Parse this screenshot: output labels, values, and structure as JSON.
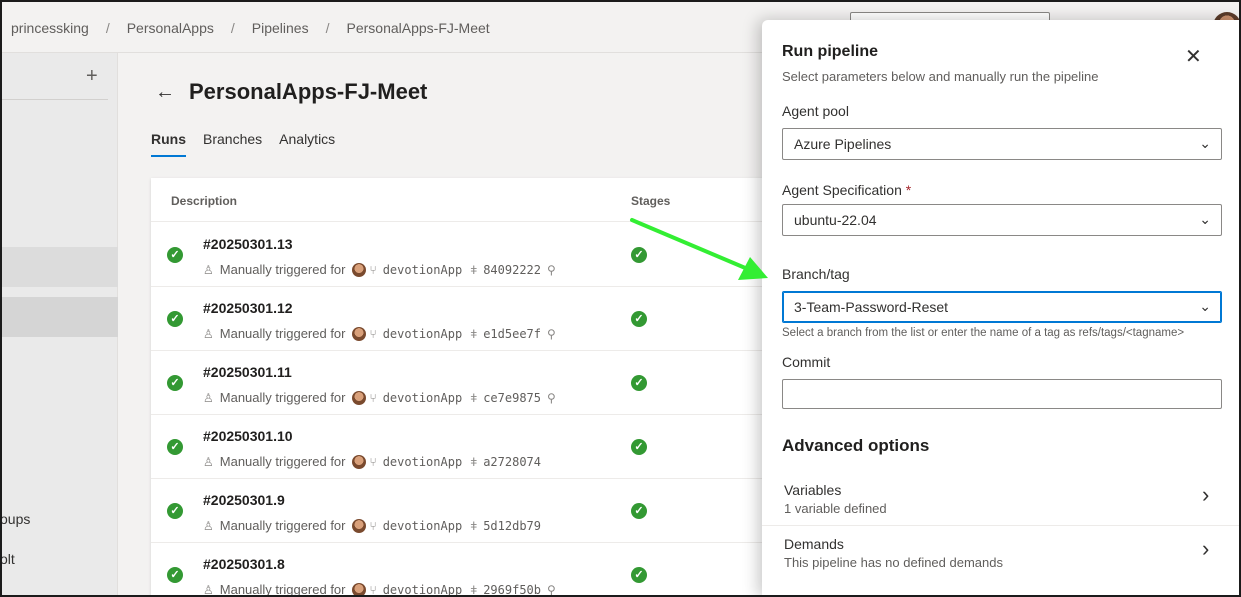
{
  "breadcrumb": [
    "princessking",
    "PersonalApps",
    "Pipelines",
    "PersonalApps-FJ-Meet"
  ],
  "breadcrumb_sep": "/",
  "sidebar": {
    "plus_label": "+",
    "items": [
      "oups",
      "olt"
    ]
  },
  "page": {
    "back_icon": "←",
    "title": "PersonalApps-FJ-Meet",
    "tabs": [
      "Runs",
      "Branches",
      "Analytics"
    ],
    "active_tab": "Runs"
  },
  "table": {
    "headers": {
      "description": "Description",
      "stages": "Stages"
    },
    "trigger_text": "Manually triggered for",
    "repo": "devotionApp",
    "rows": [
      {
        "id": "#20250301.13",
        "commit": "84092222",
        "pinned": true
      },
      {
        "id": "#20250301.12",
        "commit": "e1d5ee7f",
        "pinned": true
      },
      {
        "id": "#20250301.11",
        "commit": "ce7e9875",
        "pinned": true
      },
      {
        "id": "#20250301.10",
        "commit": "a2728074",
        "pinned": false
      },
      {
        "id": "#20250301.9",
        "commit": "5d12db79",
        "pinned": false
      },
      {
        "id": "#20250301.8",
        "commit": "2969f50b",
        "pinned": true
      }
    ]
  },
  "panel": {
    "title": "Run pipeline",
    "subtitle": "Select parameters below and manually run the pipeline",
    "close_icon": "✕",
    "agent_pool": {
      "label": "Agent pool",
      "value": "Azure Pipelines"
    },
    "agent_spec": {
      "label": "Agent Specification",
      "required_mark": "*",
      "value": "ubuntu-22.04"
    },
    "branch": {
      "label": "Branch/tag",
      "value": "3-Team-Password-Reset",
      "helper": "Select a branch from the list or enter the name of a tag as refs/tags/<tagname>"
    },
    "commit": {
      "label": "Commit",
      "value": ""
    },
    "advanced": {
      "heading": "Advanced options",
      "options": [
        {
          "title": "Variables",
          "subtitle": "1 variable defined"
        },
        {
          "title": "Demands",
          "subtitle": "This pipeline has no defined demands"
        }
      ]
    }
  },
  "colors": {
    "accent": "#0078d4",
    "success": "#339933",
    "annotation_arrow": "#33ee33",
    "required": "#a4262c"
  }
}
